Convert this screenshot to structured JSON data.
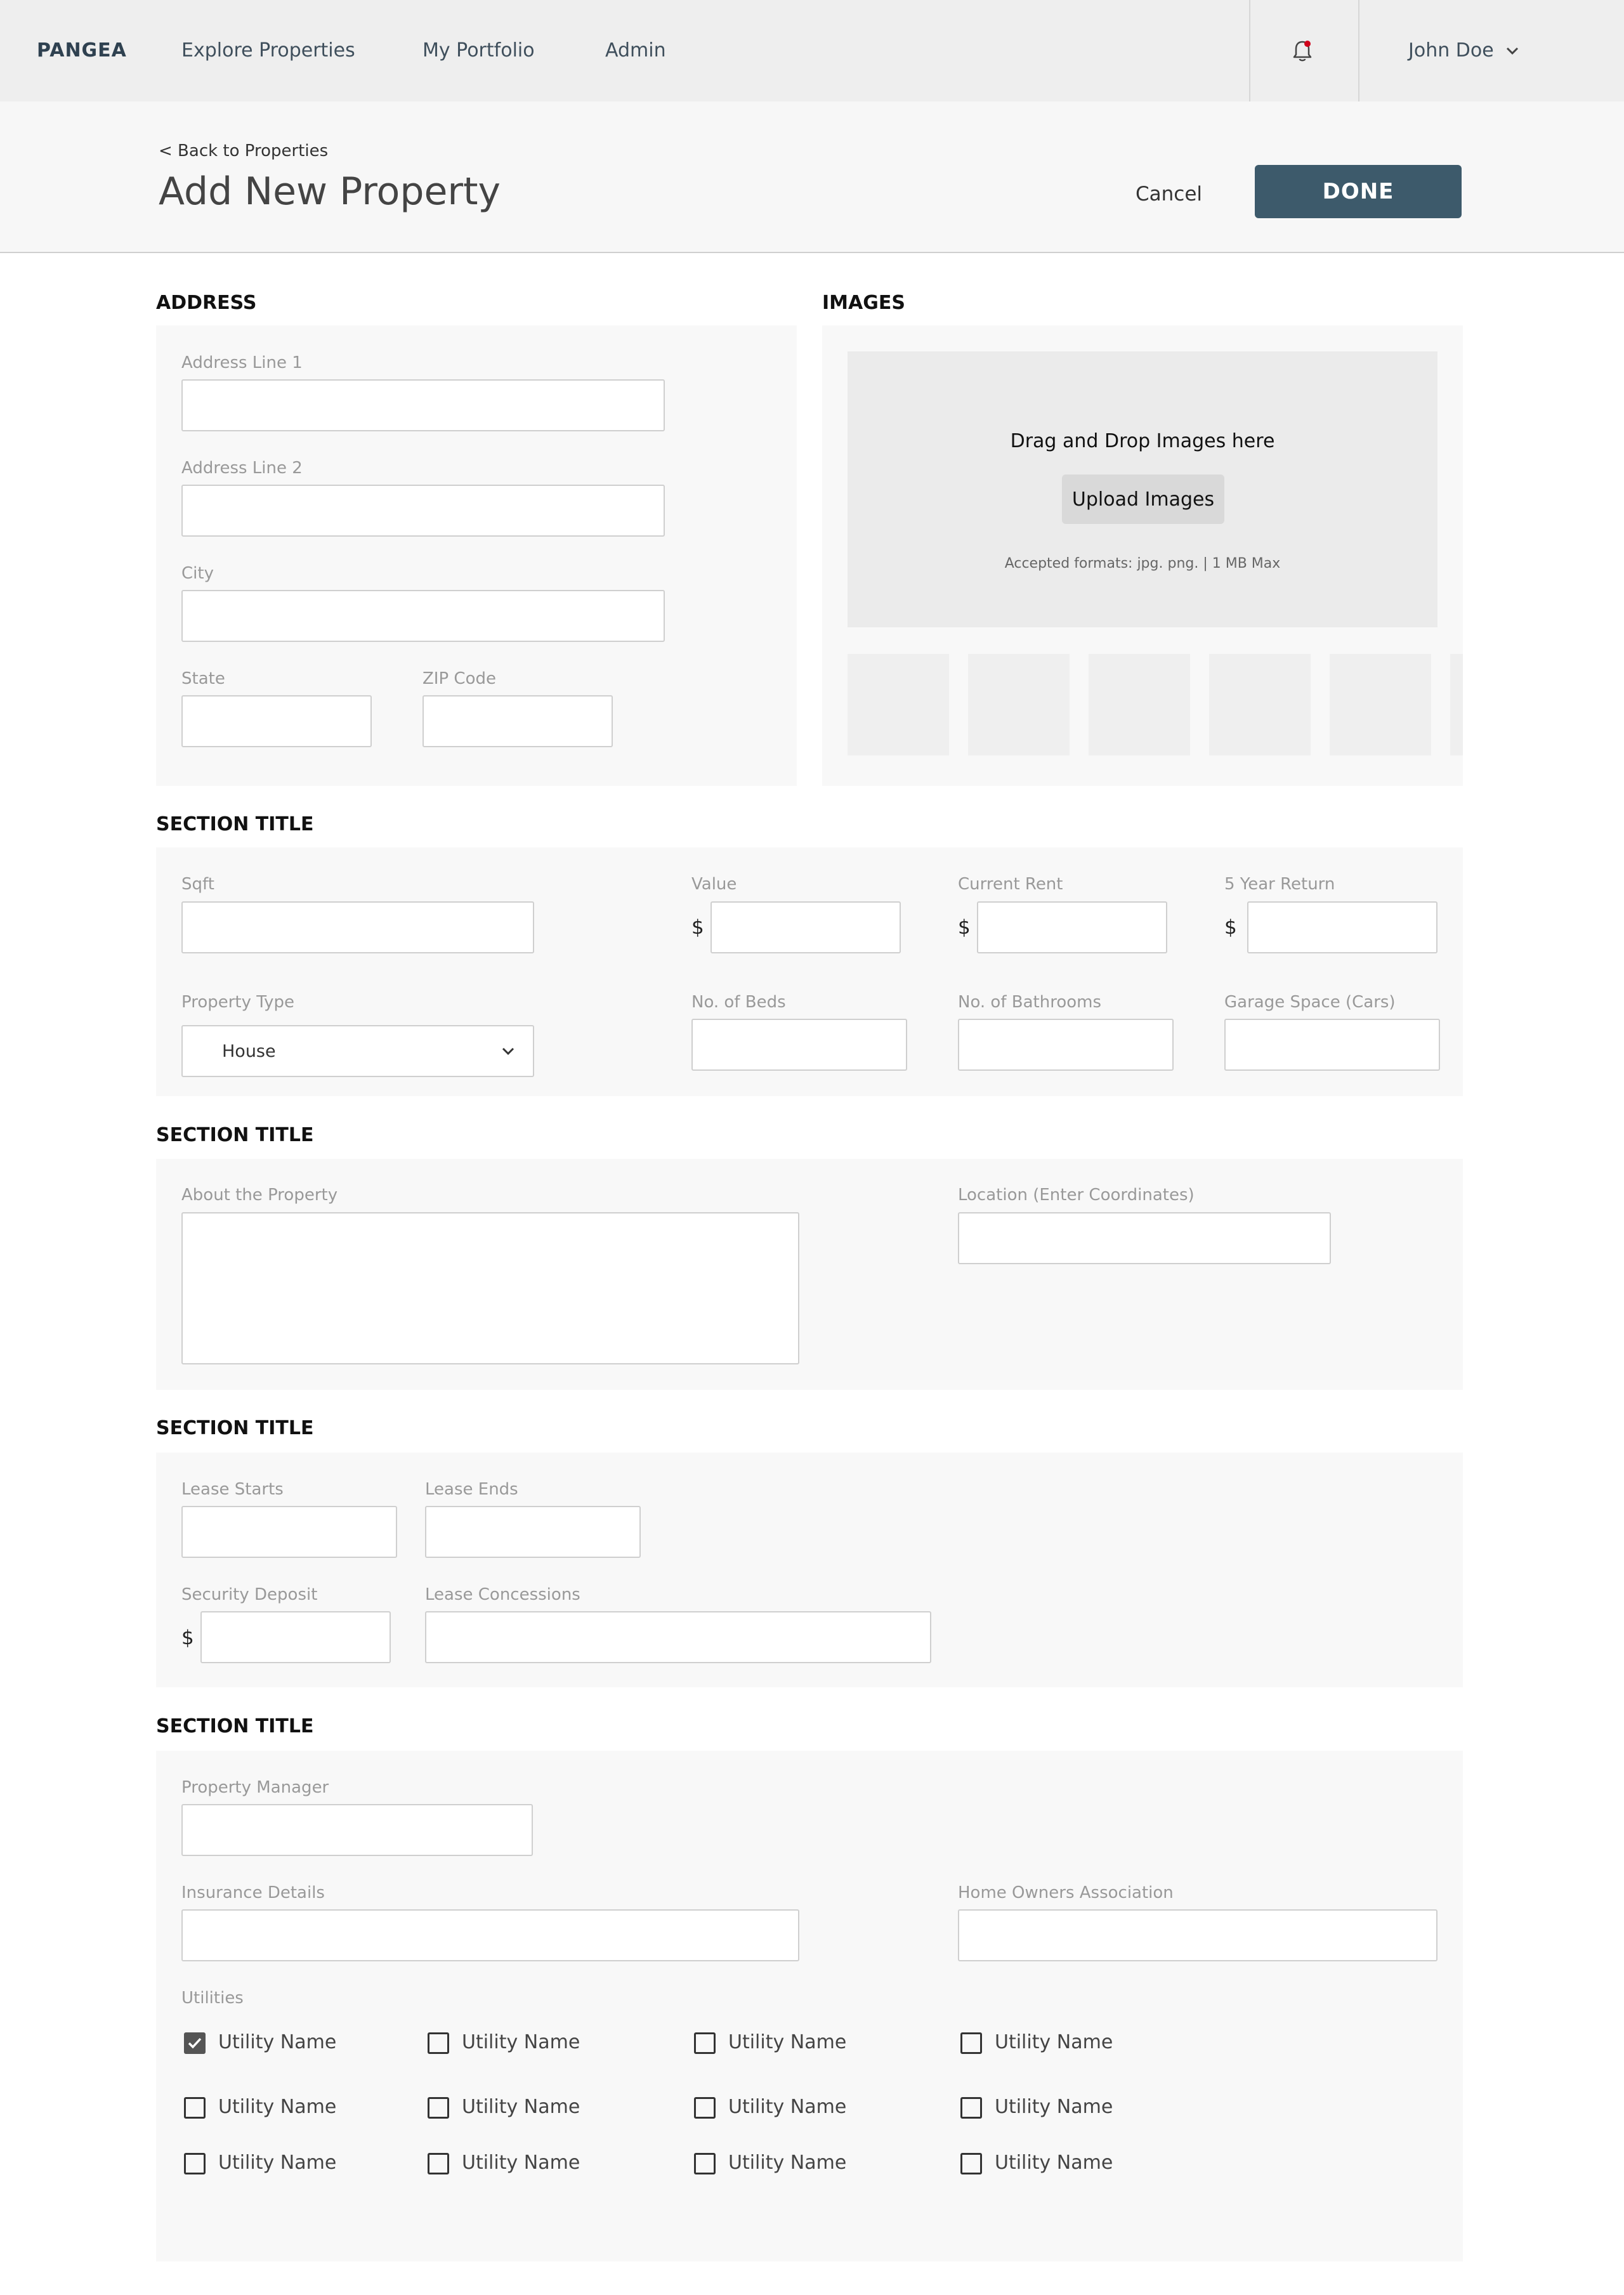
{
  "nav": {
    "brand": "PANGEA",
    "links": [
      "Explore Properties",
      "My Portfolio",
      "Admin"
    ],
    "notification_icon": "bell-icon",
    "notification_dot_color": "#d0021b",
    "user_name": "John Doe",
    "user_menu_icon": "chevron-down-icon"
  },
  "header": {
    "back_link": "< Back to Properties",
    "title": "Add New Property",
    "cancel_label": "Cancel",
    "done_label": "DONE",
    "done_color": "#3d5a6b"
  },
  "address": {
    "title": "ADDRESS",
    "line1_label": "Address Line 1",
    "line2_label": "Address Line 2",
    "city_label": "City",
    "state_label": "State",
    "zip_label": "ZIP Code"
  },
  "images": {
    "title": "IMAGES",
    "drop_text": "Drag and Drop Images here",
    "upload_label": "Upload Images",
    "formats_text": "Accepted formats: jpg. png. | 1 MB Max"
  },
  "details": {
    "title": "SECTION TITLE",
    "sqft_label": "Sqft",
    "value_label": "Value",
    "rent_label": "Current Rent",
    "return_label": "5 Year Return",
    "currency_symbol": "$",
    "type_label": "Property Type",
    "type_value": "House",
    "beds_label": "No. of Beds",
    "baths_label": "No. of Bathrooms",
    "garage_label": "Garage Space (Cars)"
  },
  "about": {
    "title": "SECTION TITLE",
    "about_label": "About the Property",
    "location_label": "Location (Enter Coordinates)"
  },
  "lease": {
    "title": "SECTION TITLE",
    "starts_label": "Lease Starts",
    "ends_label": "Lease Ends",
    "deposit_label": "Security Deposit",
    "concessions_label": "Lease Concessions",
    "currency_symbol": "$"
  },
  "management": {
    "title": "SECTION TITLE",
    "manager_label": "Property Manager",
    "insurance_label": "Insurance Details",
    "hoa_label": "Home Owners Association",
    "utilities_label": "Utilities",
    "utilities": [
      {
        "label": "Utility Name",
        "checked": true
      },
      {
        "label": "Utility Name",
        "checked": false
      },
      {
        "label": "Utility Name",
        "checked": false
      },
      {
        "label": "Utility Name",
        "checked": false
      },
      {
        "label": "Utility Name",
        "checked": false
      },
      {
        "label": "Utility Name",
        "checked": false
      },
      {
        "label": "Utility Name",
        "checked": false
      },
      {
        "label": "Utility Name",
        "checked": false
      },
      {
        "label": "Utility Name",
        "checked": false
      },
      {
        "label": "Utility Name",
        "checked": false
      },
      {
        "label": "Utility Name",
        "checked": false
      },
      {
        "label": "Utility Name",
        "checked": false
      }
    ]
  }
}
